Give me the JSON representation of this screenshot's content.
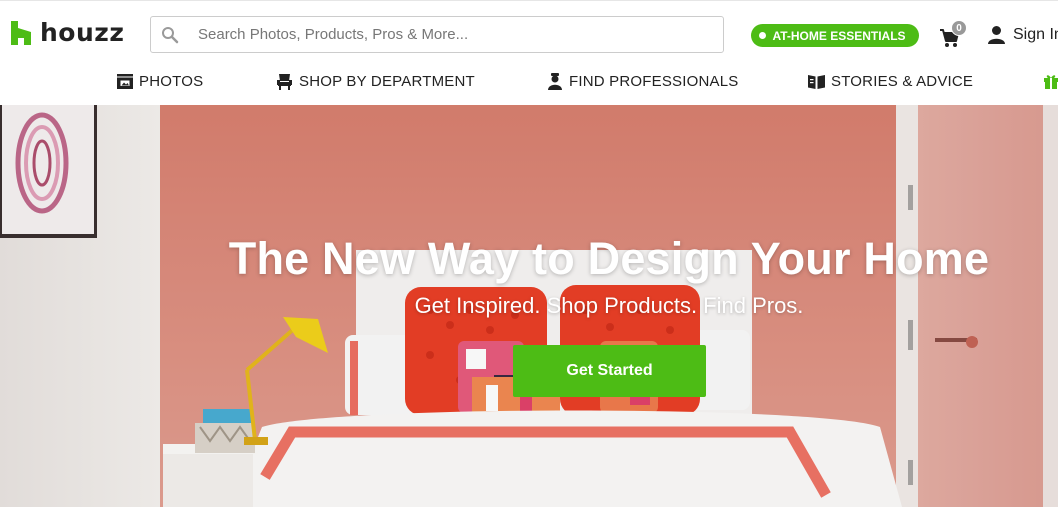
{
  "header": {
    "logo_text": "houzz",
    "search": {
      "placeholder": "Search Photos, Products, Pros & More...",
      "value": ""
    },
    "promo_label": "AT-HOME ESSENTIALS",
    "cart_count": "0",
    "signin_label": "Sign In"
  },
  "nav": {
    "items": [
      {
        "label": "PHOTOS",
        "icon": "photos-icon"
      },
      {
        "label": "SHOP BY DEPARTMENT",
        "icon": "chair-icon"
      },
      {
        "label": "FIND PROFESSIONALS",
        "icon": "professional-icon"
      },
      {
        "label": "STORIES & ADVICE",
        "icon": "book-icon"
      },
      {
        "label": "",
        "icon": "gift-icon"
      }
    ]
  },
  "hero": {
    "title": "The New Way to Design Your Home",
    "subtitle": "Get Inspired. Shop Products. Find Pros.",
    "cta_label": "Get Started"
  },
  "colors": {
    "brand_green": "#4dbc15",
    "hero_wall": "#d9877a",
    "text_dark": "#222222"
  }
}
